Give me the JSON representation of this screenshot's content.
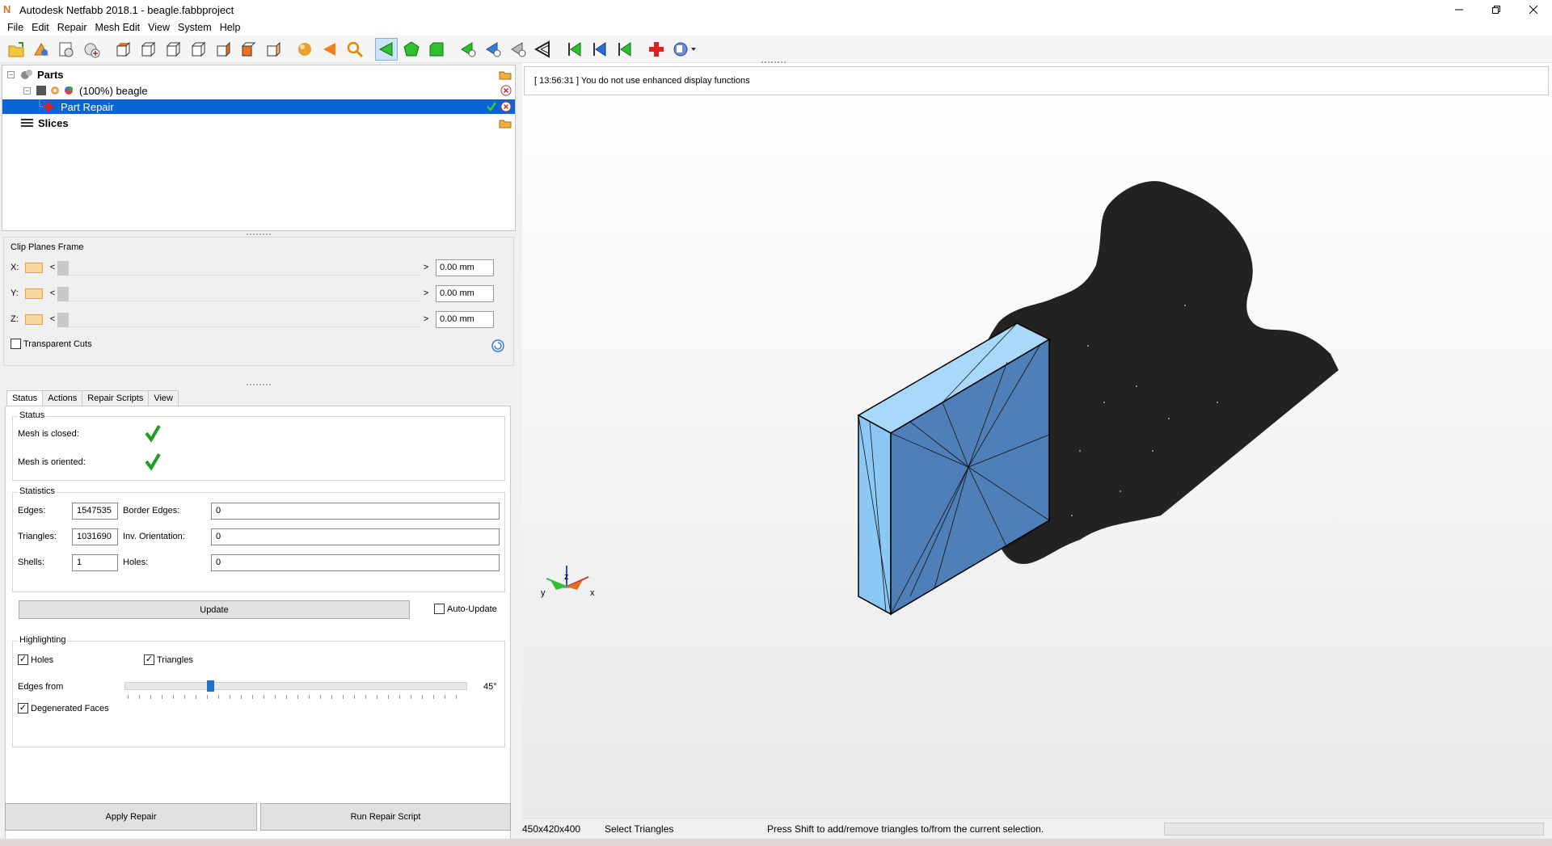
{
  "window": {
    "title": "Autodesk Netfabb 2018.1 - beagle.fabbproject",
    "controls": [
      "minimize",
      "restore",
      "close"
    ]
  },
  "menu": [
    "File",
    "Edit",
    "Repair",
    "Mesh Edit",
    "View",
    "System",
    "Help"
  ],
  "toolbar_icons": [
    "open-project-icon",
    "add-part-icon",
    "part-properties-icon",
    "new-part-icon",
    "view-top-icon",
    "view-front-icon",
    "view-left-icon",
    "view-right-icon",
    "view-back-icon",
    "view-bottom-icon",
    "view-iso-icon",
    "sphere-icon",
    "cone-icon",
    "zoom-icon",
    "select-triangle-icon",
    "select-surface-icon",
    "select-shell-icon",
    "add-triangle-icon",
    "remove-triangle-icon",
    "connect-icon",
    "move-point-icon",
    "prev-icon",
    "next-icon",
    "refresh-icon",
    "repair-cross-icon",
    "script-icon"
  ],
  "tree": {
    "parts_label": "Parts",
    "part_label": "(100%) beagle",
    "repair_label": "Part Repair",
    "slices_label": "Slices"
  },
  "clip": {
    "title": "Clip Planes Frame",
    "rows": [
      {
        "axis": "X:",
        "value": "0.00 mm"
      },
      {
        "axis": "Y:",
        "value": "0.00 mm"
      },
      {
        "axis": "Z:",
        "value": "0.00 mm"
      }
    ],
    "transparent_label": "Transparent Cuts"
  },
  "tabs": [
    "Status",
    "Actions",
    "Repair Scripts",
    "View"
  ],
  "status": {
    "title": "Status",
    "closed_label": "Mesh is closed:",
    "oriented_label": "Mesh is oriented:"
  },
  "statistics": {
    "title": "Statistics",
    "edges_label": "Edges:",
    "edges": "1547535",
    "border_label": "Border Edges:",
    "border": "0",
    "triangles_label": "Triangles:",
    "triangles": "1031690",
    "inv_label": "Inv. Orientation:",
    "inv": "0",
    "shells_label": "Shells:",
    "shells": "1",
    "holes_label": "Holes:",
    "holes": "0",
    "update_label": "Update",
    "auto_update_label": "Auto-Update"
  },
  "highlighting": {
    "title": "Highlighting",
    "holes_label": "Holes",
    "triangles_label": "Triangles",
    "edges_from_label": "Edges from",
    "edges_from_value": "45°",
    "edges_slider_level": 0.25,
    "degenerated_label": "Degenerated Faces"
  },
  "buttons": {
    "apply": "Apply Repair",
    "run_script": "Run Repair Script"
  },
  "log_message": "[ 13:56:31 ] You do not use enhanced display functions",
  "axis_labels": {
    "z": "z",
    "y": "y",
    "x": "x"
  },
  "statusbar": {
    "dimensions": "450x420x400",
    "mode": "Select Triangles",
    "hint": "Press Shift to add/remove triangles to/from the current selection."
  },
  "colors": {
    "selection": "#0a64d6",
    "mesh_dark": "#222222",
    "box_light": "#8cc8f5",
    "box_face": "#4f7fb8",
    "check_green": "#1f9d1f"
  }
}
